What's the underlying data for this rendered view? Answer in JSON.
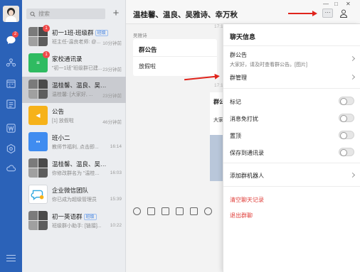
{
  "nav": {
    "chat_badge": "2",
    "contacts_label": "",
    "items": [
      "chat-icon",
      "contacts-icon",
      "calendar-icon",
      "docs-icon",
      "word-icon",
      "apps-icon",
      "cloud-icon"
    ]
  },
  "search": {
    "placeholder": "搜索"
  },
  "conversations": [
    {
      "name": "初一1班-班级群",
      "tag": "班级",
      "preview": "班主任-温良老师: @...",
      "time": "10分钟前",
      "badge": "1",
      "avatar": "group"
    },
    {
      "name": "家校通讯录",
      "tag": "",
      "preview": "\"初一1班\"班级群已建...",
      "time": "23分钟前",
      "badge": "1",
      "avatar": "green"
    },
    {
      "name": "温桂馨、温良、吴雅诗...",
      "tag": "",
      "preview": "温桂馨: [大家好, ...",
      "time": "23分钟前",
      "badge": "",
      "avatar": "group"
    },
    {
      "name": "公告",
      "tag": "",
      "preview": "[1] 放假啦",
      "time": "46分钟前",
      "badge": "",
      "avatar": "yellow"
    },
    {
      "name": "班小二",
      "tag": "",
      "preview": "教师节福利, 点击即...",
      "time": "16:14",
      "badge": "",
      "avatar": "blue"
    },
    {
      "name": "温桂馨、温良、吴雅诗、幸万秋",
      "tag": "",
      "preview": "你修改群名为 \"温桂...",
      "time": "16:03",
      "badge": "",
      "avatar": "group"
    },
    {
      "name": "企业微信团队",
      "tag": "",
      "preview": "你已成为超级管理员",
      "time": "15:39",
      "badge": "",
      "avatar": "bot"
    },
    {
      "name": "初一英语群",
      "tag": "班级",
      "preview": "班级群小助手: [链接]...",
      "time": "10:22",
      "badge": "",
      "avatar": "group"
    }
  ],
  "chat": {
    "title": "温桂馨、温良、吴雅诗、幸万秋",
    "time_1": "17:1",
    "sender": "吴雅诗",
    "notice_card_title": "群公告",
    "notice_card_text": "放假啦",
    "time_2": "17:1",
    "msg_title": "群公",
    "msg_preview": "大家"
  },
  "panel": {
    "title": "聊天信息",
    "notice_label": "群公告",
    "notice_text": "大家好，请及时查看群公告。[图片]",
    "group_manage": "群管理",
    "mark": "标记",
    "mute": "消息免打扰",
    "pin": "置顶",
    "save_contacts": "保存到通讯录",
    "add_robot": "添加群机器人",
    "clear_history": "清空聊天记录",
    "quit_group": "退出群聊"
  },
  "colors": {
    "rail": "#2b62b8",
    "accent_red": "#e0241c",
    "danger": "#e0413c"
  }
}
